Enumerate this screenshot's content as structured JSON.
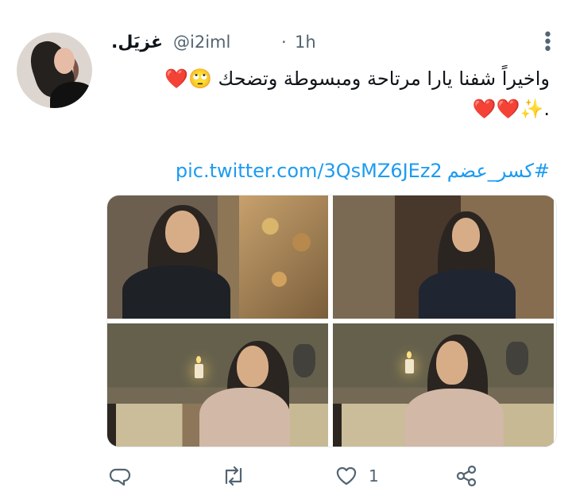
{
  "tweet": {
    "display_name": "غزيَل.",
    "handle": "@i2iml",
    "separator": "·",
    "time": "1h",
    "line1": "واخيراً شفنا يارا مرتاحة ومبسوطة وتضحك 🙄❤️",
    "line2": "❤️❤️✨.",
    "hashtag": "#كسر_عضم",
    "link": "pic.twitter.com/3QsMZ6JEz2",
    "likes": "1"
  },
  "icons": {
    "more": "more-vertical-icon",
    "reply": "reply-icon",
    "retweet": "retweet-icon",
    "like": "heart-icon",
    "share": "share-icon"
  },
  "colors": {
    "text": "#0f1419",
    "secondary": "#536471",
    "link": "#1d9bf0",
    "heart": "#d7192a"
  }
}
